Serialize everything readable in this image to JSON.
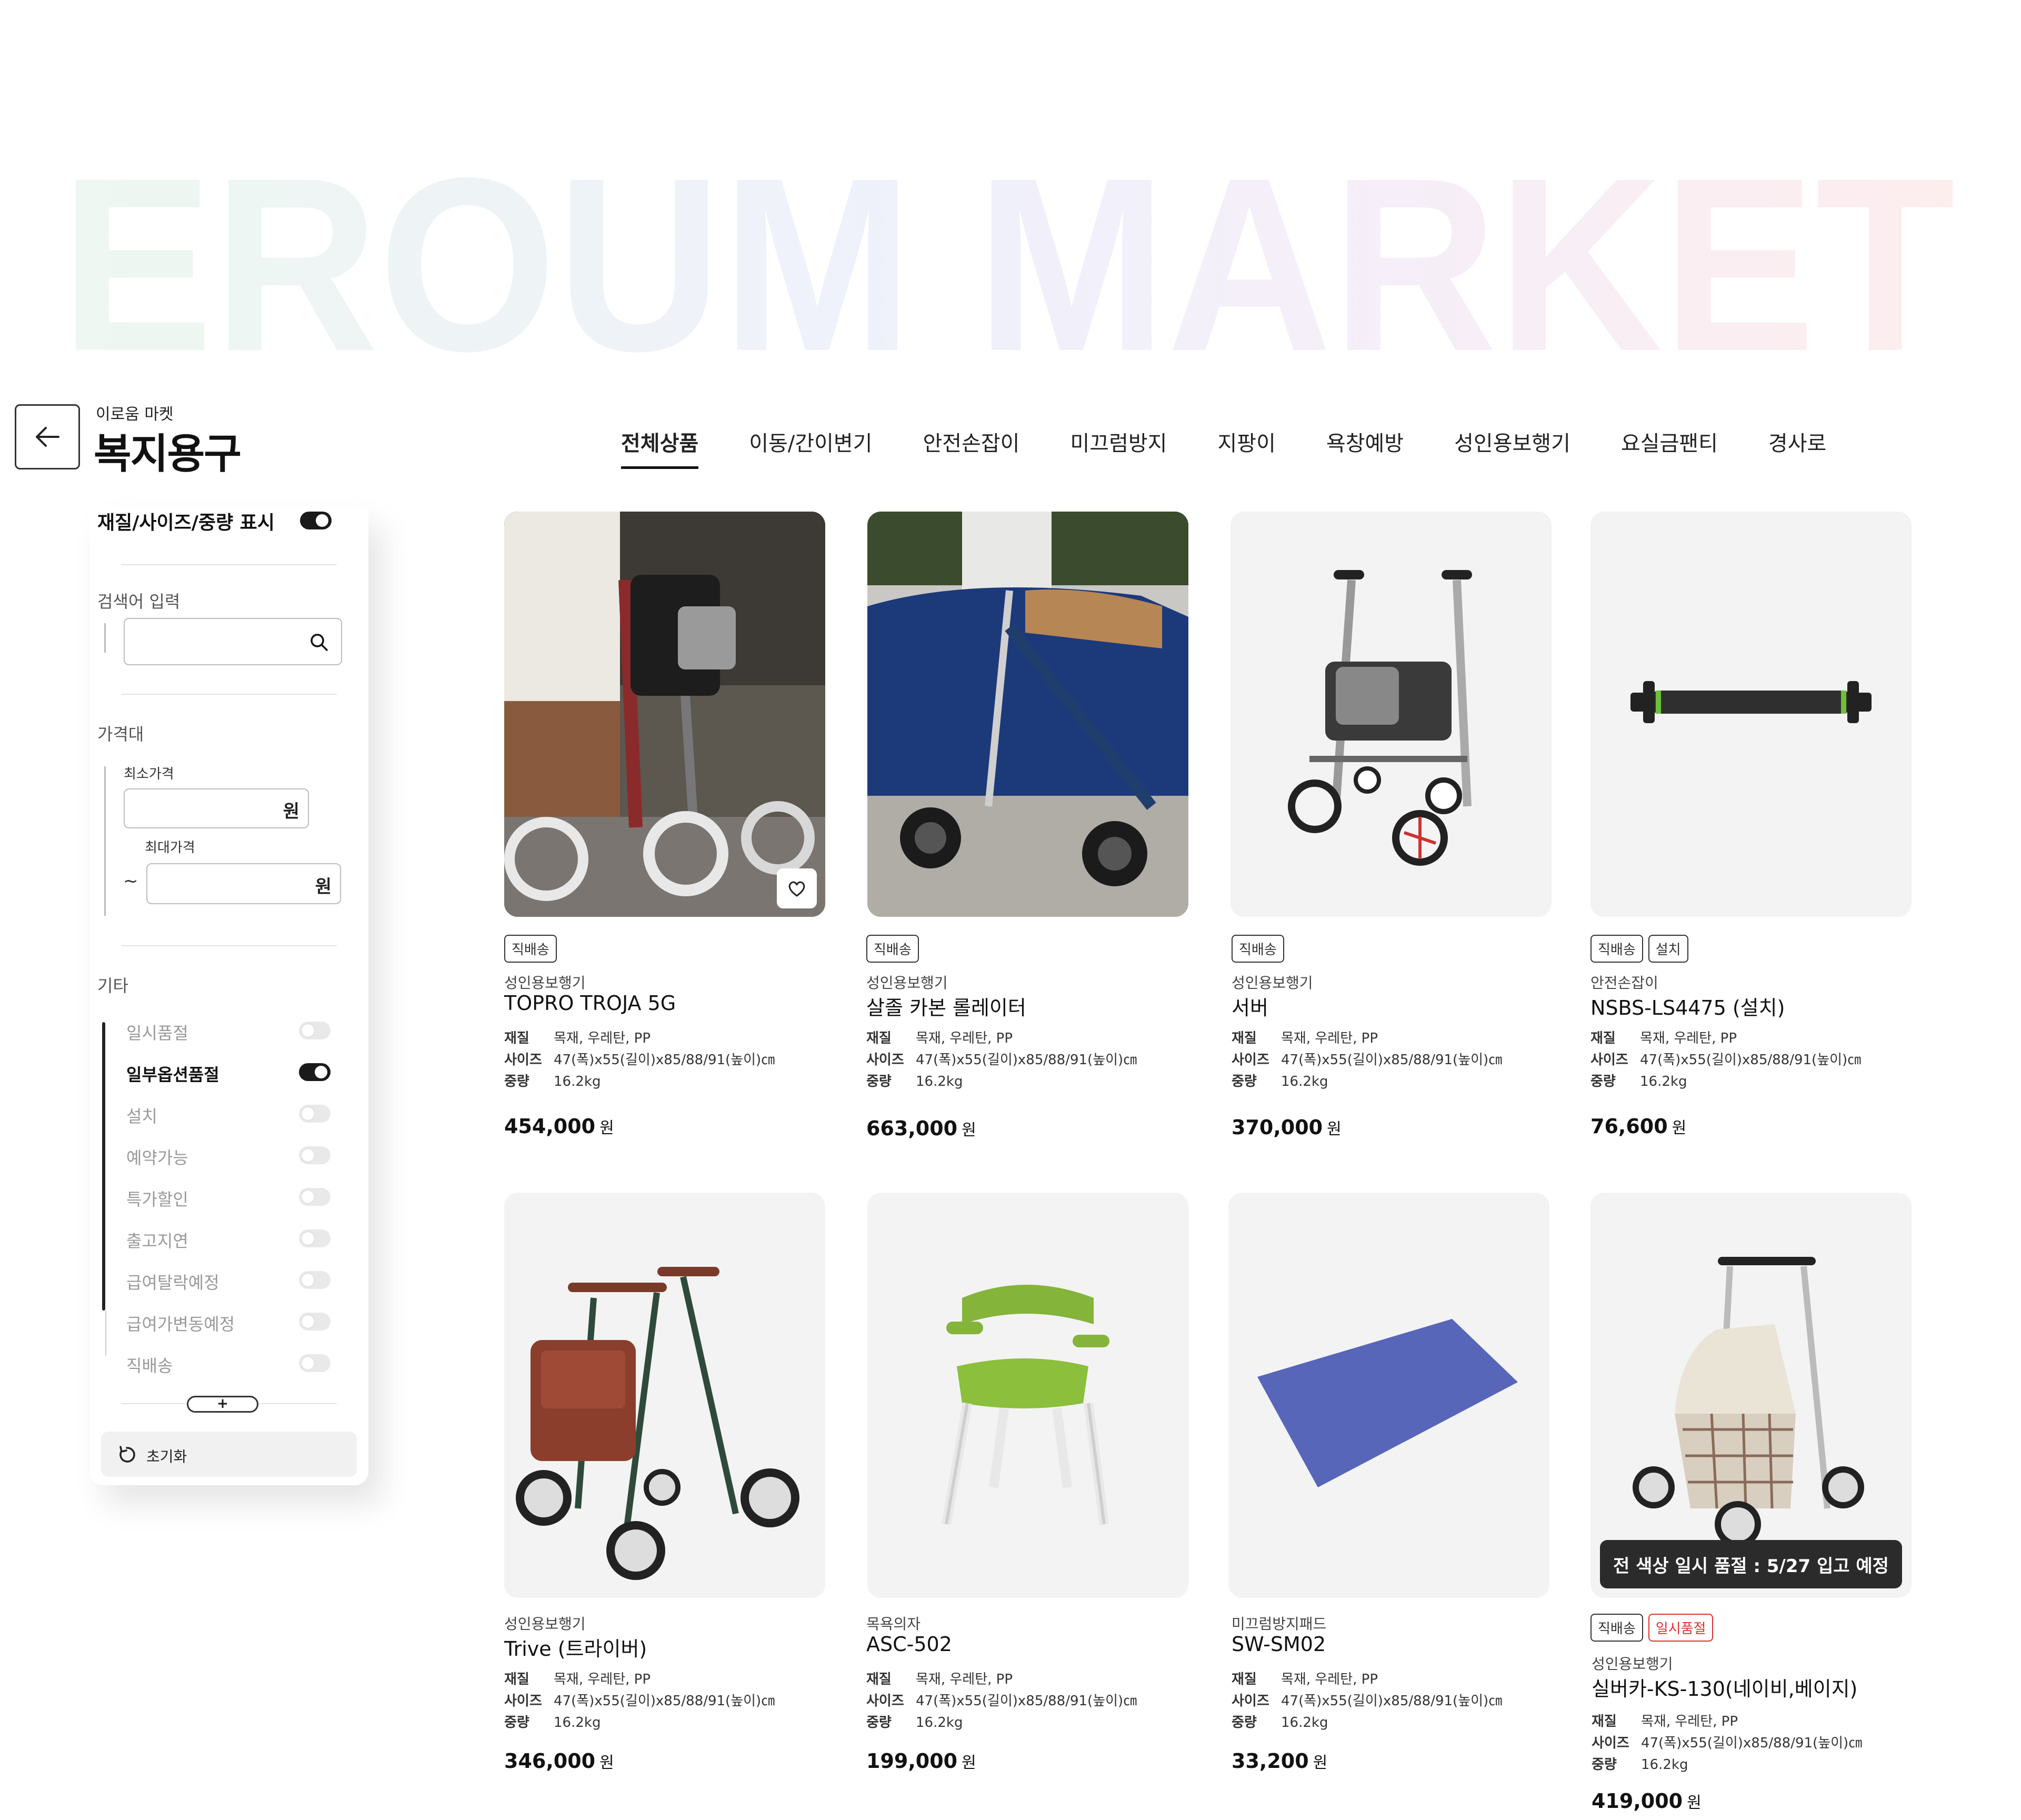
{
  "watermark": {
    "text": "EROUM MARKET"
  },
  "header": {
    "brand_sub": "이로움 마켓",
    "title": "복지용구"
  },
  "tabs": [
    {
      "label": "전체상품",
      "active": true
    },
    {
      "label": "이동/간이변기"
    },
    {
      "label": "안전손잡이"
    },
    {
      "label": "미끄럼방지"
    },
    {
      "label": "지팡이"
    },
    {
      "label": "욕창예방"
    },
    {
      "label": "성인용보행기"
    },
    {
      "label": "요실금팬티"
    },
    {
      "label": "경사로"
    }
  ],
  "sidebar": {
    "spec_toggle_label": "재질/사이즈/중량 표시",
    "spec_toggle_on": true,
    "search_label": "검색어 입력",
    "price_label": "가격대",
    "min_price_label": "최소가격",
    "max_price_label": "최대가격",
    "currency": "원",
    "tilde": "~",
    "etc_label": "기타",
    "filters": [
      {
        "label": "일시품절",
        "on": false
      },
      {
        "label": "일부옵션품절",
        "on": true
      },
      {
        "label": "설치",
        "on": false
      },
      {
        "label": "예약가능",
        "on": false
      },
      {
        "label": "특가할인",
        "on": false
      },
      {
        "label": "출고지연",
        "on": false
      },
      {
        "label": "급여탈락예정",
        "on": false
      },
      {
        "label": "급여가변동예정",
        "on": false
      },
      {
        "label": "직배송",
        "on": false
      }
    ],
    "more_label": "+",
    "reset_label": "초기화"
  },
  "spec_labels": {
    "material": "재질",
    "size": "사이즈",
    "weight": "중량"
  },
  "products": [
    {
      "badges": [
        "직배송"
      ],
      "category": "성인용보행기",
      "name": "TOPRO TROJA 5G",
      "material": "목재, 우레탄, PP",
      "size": "47(폭)x55(길이)x85/88/91(높이)㎝",
      "weight": "16.2kg",
      "price": "454,000",
      "unit": "원"
    },
    {
      "badges": [
        "직배송"
      ],
      "category": "성인용보행기",
      "name": "살졸 카본 롤레이터",
      "material": "목재, 우레탄, PP",
      "size": "47(폭)x55(길이)x85/88/91(높이)㎝",
      "weight": "16.2kg",
      "price": "663,000",
      "unit": "원"
    },
    {
      "badges": [
        "직배송"
      ],
      "category": "성인용보행기",
      "name": "서버",
      "material": "목재, 우레탄, PP",
      "size": "47(폭)x55(길이)x85/88/91(높이)㎝",
      "weight": "16.2kg",
      "price": "370,000",
      "unit": "원"
    },
    {
      "badges": [
        "직배송",
        "설치"
      ],
      "category": "안전손잡이",
      "name": "NSBS-LS4475 (설치)",
      "material": "목재, 우레탄, PP",
      "size": "47(폭)x55(길이)x85/88/91(높이)㎝",
      "weight": "16.2kg",
      "price": "76,600",
      "unit": "원"
    },
    {
      "badges": [],
      "category": "성인용보행기",
      "name": "Trive (트라이버)",
      "material": "목재, 우레탄, PP",
      "size": "47(폭)x55(길이)x85/88/91(높이)㎝",
      "weight": "16.2kg",
      "price": "346,000",
      "unit": "원"
    },
    {
      "badges": [],
      "category": "목욕의자",
      "name": "ASC-502",
      "material": "목재, 우레탄, PP",
      "size": "47(폭)x55(길이)x85/88/91(높이)㎝",
      "weight": "16.2kg",
      "price": "199,000",
      "unit": "원"
    },
    {
      "badges": [],
      "category": "미끄럼방지패드",
      "name": "SW-SM02",
      "material": "목재, 우레탄, PP",
      "size": "47(폭)x55(길이)x85/88/91(높이)㎝",
      "weight": "16.2kg",
      "price": "33,200",
      "unit": "원"
    },
    {
      "badges": [
        "직배송"
      ],
      "red_badges": [
        "일시품절"
      ],
      "category": "성인용보행기",
      "name": "실버카-KS-130(네이비,베이지)",
      "material": "목재, 우레탄, PP",
      "size": "47(폭)x55(길이)x85/88/91(높이)㎝",
      "weight": "16.2kg",
      "price": "419,000",
      "unit": "원",
      "notice": "전 색상 일시 품절 : 5/27 입고 예정"
    }
  ]
}
